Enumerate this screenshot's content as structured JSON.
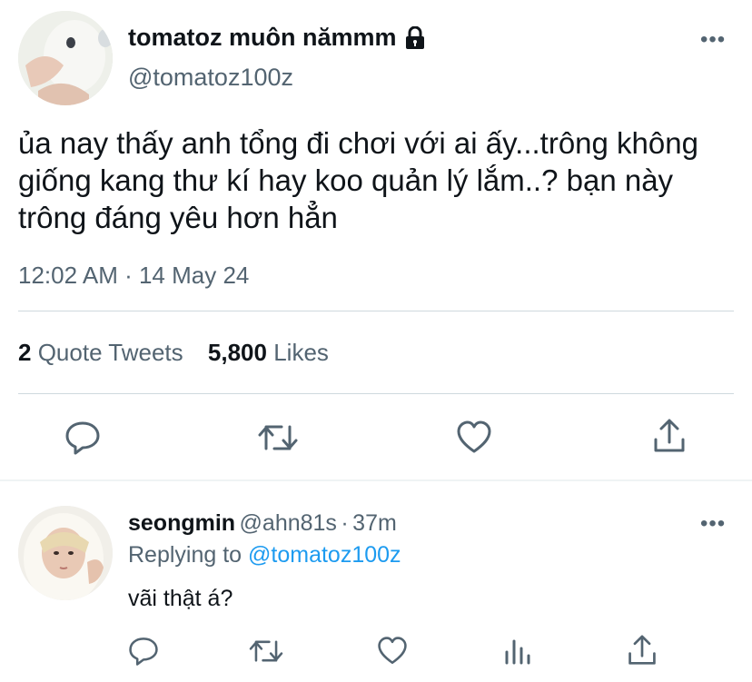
{
  "tweet": {
    "display_name": "tomatoz muôn nămmm",
    "handle": "@tomatoz100z",
    "text": "ủa nay thấy anh tổng đi chơi với ai ấy...trông không giống kang thư kí hay koo quản lý lắm..? bạn này trông đáng yêu hơn hẳn",
    "timestamp": "12:02 AM · 14 May 24",
    "quote_tweets_count": "2",
    "quote_tweets_label": "Quote Tweets",
    "likes_count": "5,800",
    "likes_label": "Likes",
    "more_label": "•••",
    "icons": [
      "reply-icon",
      "retweet-icon",
      "like-icon",
      "share-icon",
      "lock-icon"
    ]
  },
  "reply": {
    "display_name": "seongmin",
    "handle": "@ahn81s",
    "separator": "·",
    "time": "37m",
    "replying_prefix": "Replying to",
    "replying_handle": "@tomatoz100z",
    "text": "vãi thật á?",
    "more_label": "•••",
    "icons": [
      "reply-icon",
      "retweet-icon",
      "like-icon",
      "analytics-icon",
      "share-icon"
    ]
  },
  "colors": {
    "text": "#0f1419",
    "secondary": "#536471",
    "accent": "#1d9bf0",
    "divider": "#cfd9de",
    "section_divider": "#eff3f4"
  }
}
